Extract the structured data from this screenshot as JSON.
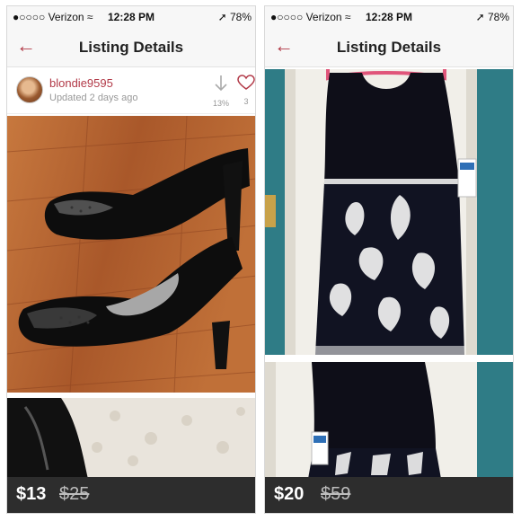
{
  "screens": [
    {
      "status": {
        "carrier": "●○○○○ Verizon ≈",
        "time": "12:28 PM",
        "battery": "➚ 78%"
      },
      "nav": {
        "back": "←",
        "title": "Listing Details"
      },
      "seller": {
        "username": "blondie9595",
        "updated": "Updated 2 days ago"
      },
      "actions": {
        "share_icon": "download-arrow-icon",
        "share_count": "13%",
        "like_icon": "heart-icon",
        "like_count": "3"
      },
      "price": {
        "current": "$13",
        "original": "$25"
      }
    },
    {
      "status": {
        "carrier": "●○○○○ Verizon ≈",
        "time": "12:28 PM",
        "battery": "➚ 78%"
      },
      "nav": {
        "back": "←",
        "title": "Listing Details"
      },
      "price": {
        "current": "$20",
        "original": "$59"
      }
    }
  ],
  "colors": {
    "accent": "#b23a48",
    "price_bar": "#2d2d2d",
    "wood_floor": "#b4622d",
    "teal_wall": "#2f7c86"
  }
}
